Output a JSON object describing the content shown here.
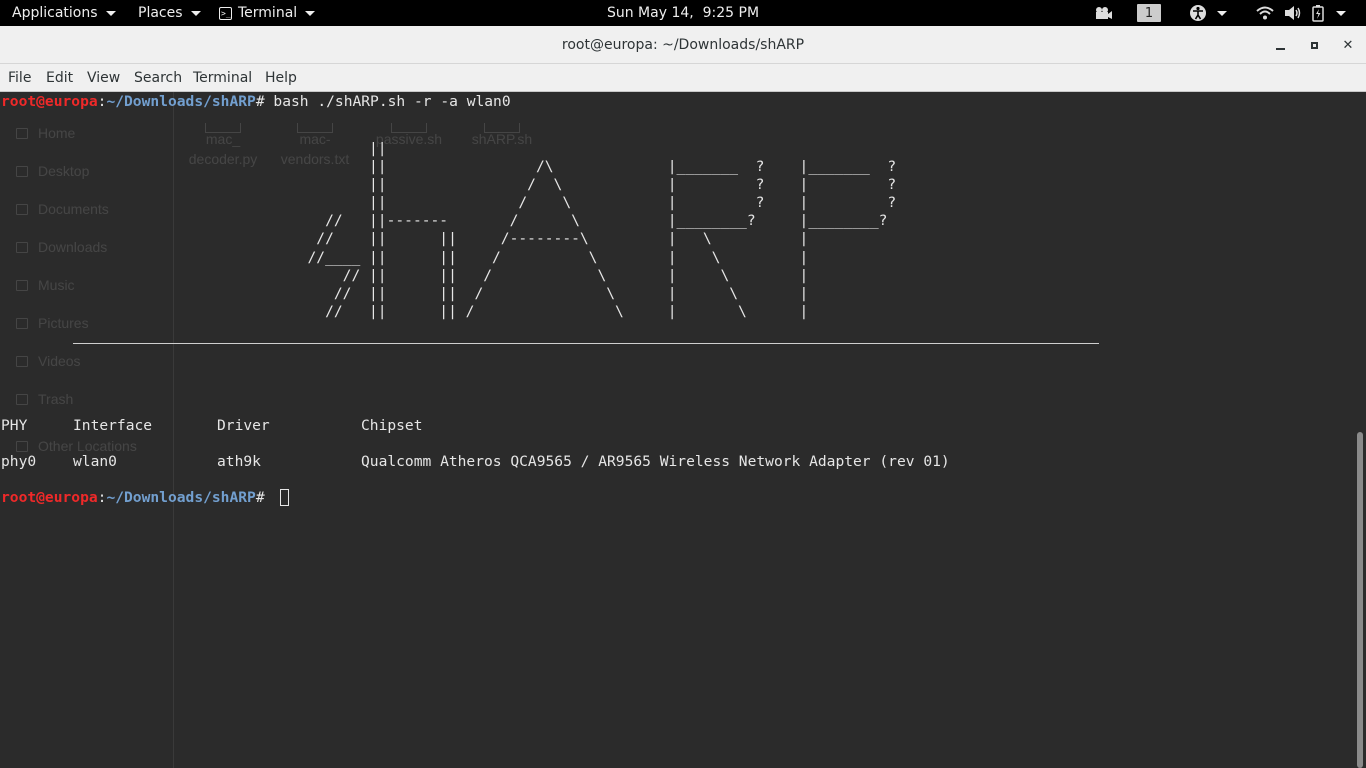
{
  "top_panel": {
    "applications_label": "Applications",
    "places_label": "Places",
    "terminal_label": "Terminal",
    "clock": "Sun May 14,  9:25 PM",
    "workspace_number": "1"
  },
  "window": {
    "title": "root@europa: ~/Downloads/shARP",
    "minimize_glyph": "▁",
    "maximize_glyph": "▪",
    "close_glyph": "✕"
  },
  "menubar": {
    "items": [
      "File",
      "Edit",
      "View",
      "Search",
      "Terminal",
      "Help"
    ]
  },
  "background_file_manager": {
    "sidebar_items": [
      "Home",
      "Desktop",
      "Documents",
      "Downloads",
      "Music",
      "Pictures",
      "Videos",
      "Trash",
      "Other Locations"
    ],
    "files": [
      {
        "line1": "mac_",
        "line2": "decoder.py"
      },
      {
        "line1": "mac-",
        "line2": "vendors.txt"
      },
      {
        "line1": "passive.sh",
        "line2": ""
      },
      {
        "line1": "shARP.sh",
        "line2": ""
      }
    ]
  },
  "terminal": {
    "prompt_user": "root@europa",
    "prompt_sep": ":",
    "prompt_path": "~/Downloads/shARP",
    "prompt_symbol": "# ",
    "command": "bash ./shARP.sh -r -a wlan0",
    "ascii_art": "                                          ||\n                                          ||                 /\\             |_______  ?    |_______  ?\n                                          ||                /  \\            |         ?    |         ?\n                                          ||               /    \\           |         ?    |         ?\n                                     //   ||-------       /      \\          |________?     |________?\n                                    //    ||      ||     /--------\\         |   \\          |\n                                   //____ ||      ||    /          \\        |    \\         |\n                                       // ||      ||   /            \\       |     \\        |\n                                      //  ||      ||  /              \\      |      \\       |\n                                     //   ||      || /                \\     |       \\      |",
    "table_headers": [
      "PHY",
      "Interface",
      "Driver",
      "Chipset"
    ],
    "table_row": [
      "phy0",
      "wlan0",
      "ath9k",
      "Qualcomm Atheros QCA9565 / AR9565 Wireless Network Adapter (rev 01)"
    ]
  },
  "colors": {
    "terminal_bg": "#2b2b2b",
    "prompt_user": "#ef2929",
    "prompt_path": "#729fcf",
    "panel_bg": "#000000",
    "titlebar_bg": "#f0f0f0"
  }
}
